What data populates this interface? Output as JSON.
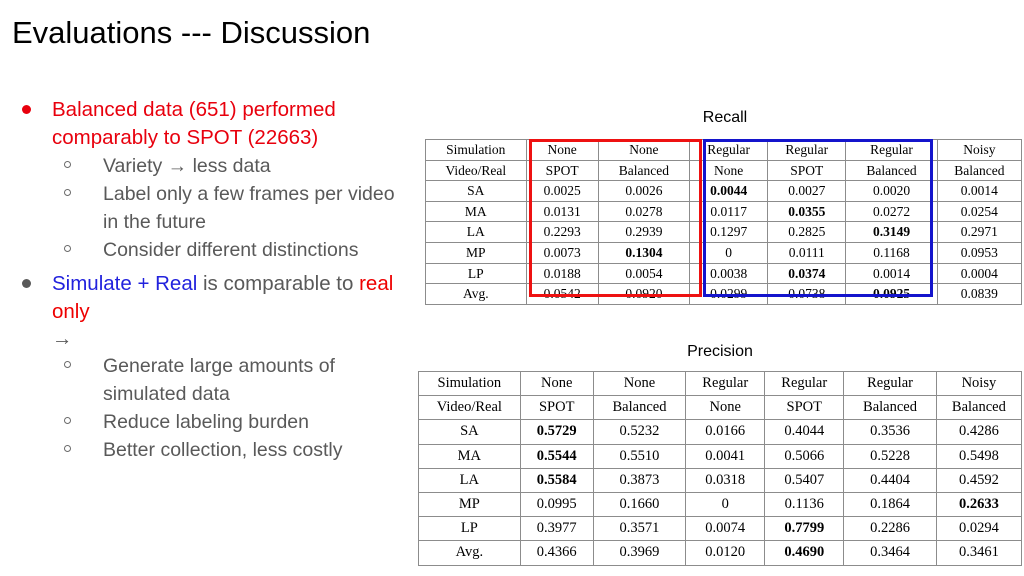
{
  "slide": {
    "title": "Evaluations --- Discussion"
  },
  "bullets": [
    {
      "marker": "filled-disc",
      "color_name": "red",
      "text": "Balanced data (651) performed comparably to SPOT (22663)",
      "sub_items": [
        "Variety → less data",
        "Label only a few frames per video in the future",
        "Consider different distinctions"
      ]
    },
    {
      "marker": "filled-disc",
      "color_name": "gray",
      "segments": [
        {
          "text": "Simulate + Real",
          "color": "#2222dd"
        },
        {
          "text": " is  comparable to ",
          "color": "#595959"
        },
        {
          "text": "real only",
          "color": "#ee0000"
        }
      ],
      "arrow": "→",
      "sub_items": [
        "Generate large amounts of simulated data",
        "Reduce labeling burden",
        "Better collection, less costly"
      ]
    }
  ],
  "colors": {
    "red_text": "#e8000d",
    "red_box": "#ee1111",
    "blue_box": "#1414cc",
    "blue_text": "#2222dd",
    "gray_text": "#595959"
  },
  "tables": [
    {
      "id": "recall",
      "caption": "Recall",
      "header_rows": [
        [
          "Simulation",
          "None",
          "None",
          "Regular",
          "Regular",
          "Regular",
          "Noisy"
        ],
        [
          "Video/Real",
          "SPOT",
          "Balanced",
          "None",
          "SPOT",
          "Balanced",
          "Balanced"
        ]
      ],
      "rows": [
        {
          "label": "SA",
          "values": [
            "0.0025",
            "0.0026",
            "0.0044",
            "0.0027",
            "0.0020",
            "0.0014"
          ],
          "bold": [
            false,
            false,
            true,
            false,
            false,
            false
          ]
        },
        {
          "label": "MA",
          "values": [
            "0.0131",
            "0.0278",
            "0.0117",
            "0.0355",
            "0.0272",
            "0.0254"
          ],
          "bold": [
            false,
            false,
            false,
            true,
            false,
            false
          ]
        },
        {
          "label": "LA",
          "values": [
            "0.2293",
            "0.2939",
            "0.1297",
            "0.2825",
            "0.3149",
            "0.2971"
          ],
          "bold": [
            false,
            false,
            false,
            false,
            true,
            false
          ]
        },
        {
          "label": "MP",
          "values": [
            "0.0073",
            "0.1304",
            "0",
            "0.0111",
            "0.1168",
            "0.0953"
          ],
          "bold": [
            false,
            true,
            false,
            false,
            false,
            false
          ]
        },
        {
          "label": "LP",
          "values": [
            "0.0188",
            "0.0054",
            "0.0038",
            "0.0374",
            "0.0014",
            "0.0004"
          ],
          "bold": [
            false,
            false,
            false,
            true,
            false,
            false
          ]
        },
        {
          "label": "Avg.",
          "values": [
            "0.0542",
            "0.0920",
            "0.0299",
            "0.0738",
            "0.0925",
            "0.0839"
          ],
          "bold": [
            false,
            false,
            false,
            false,
            true,
            false
          ]
        }
      ],
      "highlight_boxes": [
        {
          "color": "#ee1111",
          "columns": [
            "None/SPOT",
            "None/Balanced"
          ]
        },
        {
          "color": "#1414cc",
          "columns": [
            "Regular/None",
            "Regular/SPOT",
            "Regular/Balanced"
          ]
        }
      ]
    },
    {
      "id": "precision",
      "caption": "Precision",
      "header_rows": [
        [
          "Simulation",
          "None",
          "None",
          "Regular",
          "Regular",
          "Regular",
          "Noisy"
        ],
        [
          "Video/Real",
          "SPOT",
          "Balanced",
          "None",
          "SPOT",
          "Balanced",
          "Balanced"
        ]
      ],
      "rows": [
        {
          "label": "SA",
          "values": [
            "0.5729",
            "0.5232",
            "0.0166",
            "0.4044",
            "0.3536",
            "0.4286"
          ],
          "bold": [
            true,
            false,
            false,
            false,
            false,
            false
          ]
        },
        {
          "label": "MA",
          "values": [
            "0.5544",
            "0.5510",
            "0.0041",
            "0.5066",
            "0.5228",
            "0.5498"
          ],
          "bold": [
            true,
            false,
            false,
            false,
            false,
            false
          ]
        },
        {
          "label": "LA",
          "values": [
            "0.5584",
            "0.3873",
            "0.0318",
            "0.5407",
            "0.4404",
            "0.4592"
          ],
          "bold": [
            true,
            false,
            false,
            false,
            false,
            false
          ]
        },
        {
          "label": "MP",
          "values": [
            "0.0995",
            "0.1660",
            "0",
            "0.1136",
            "0.1864",
            "0.2633"
          ],
          "bold": [
            false,
            false,
            false,
            false,
            false,
            true
          ]
        },
        {
          "label": "LP",
          "values": [
            "0.3977",
            "0.3571",
            "0.0074",
            "0.7799",
            "0.2286",
            "0.0294"
          ],
          "bold": [
            false,
            false,
            false,
            true,
            false,
            false
          ]
        },
        {
          "label": "Avg.",
          "values": [
            "0.4366",
            "0.3969",
            "0.0120",
            "0.4690",
            "0.3464",
            "0.3461"
          ],
          "bold": [
            false,
            false,
            false,
            true,
            false,
            false
          ]
        }
      ],
      "highlight_boxes": []
    }
  ]
}
